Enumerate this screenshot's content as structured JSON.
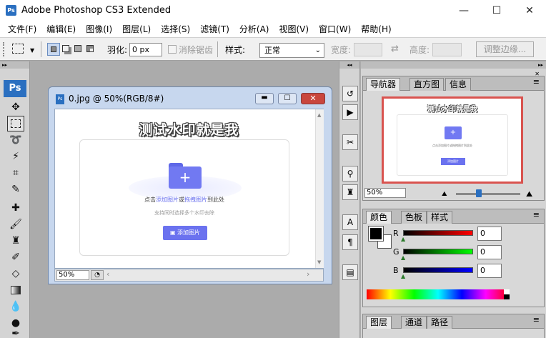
{
  "app": {
    "icon_text": "Ps",
    "title": "Adobe Photoshop CS3 Extended"
  },
  "window_controls": {
    "minimize": "—",
    "maximize": "☐",
    "close": "✕"
  },
  "menu": [
    "文件(F)",
    "编辑(E)",
    "图像(I)",
    "图层(L)",
    "选择(S)",
    "滤镜(T)",
    "分析(A)",
    "视图(V)",
    "窗口(W)",
    "帮助(H)"
  ],
  "options": {
    "feather_label": "羽化:",
    "feather_value": "0 px",
    "antialias_label": "消除锯齿",
    "style_label": "样式:",
    "style_value": "正常",
    "width_label": "宽度:",
    "height_label": "高度:",
    "refine_button": "调整边缘..."
  },
  "toolbox": {
    "logo": "Ps",
    "tools": [
      "move-tool",
      "marquee-tool",
      "lasso-tool",
      "magic-wand-tool",
      "crop-tool",
      "slice-tool",
      "healing-brush-tool",
      "brush-tool",
      "clone-stamp-tool",
      "history-brush-tool",
      "eraser-tool",
      "gradient-tool",
      "blur-tool",
      "dodge-tool",
      "pen-tool"
    ]
  },
  "document": {
    "title": "0.jpg @ 50%(RGB/8#)",
    "watermark": "测试水印就是我",
    "upload_line_prefix": "点击",
    "upload_link_add": "添加图片",
    "upload_line_or": "或",
    "upload_link_drag": "拖拽图片",
    "upload_line_suffix": "到此处",
    "upload_hint": "支持同时选择多个水印去除",
    "add_button": "添加图片",
    "zoom": "50%"
  },
  "navigator_panel": {
    "tabs": [
      "导航器",
      "直方图",
      "信息"
    ],
    "zoom": "50%",
    "thumb_watermark": "测试水印就是我",
    "thumb_upload": "点击添加图片或拖拽图片到此处",
    "thumb_button": "添加图片"
  },
  "color_panel": {
    "tabs": [
      "颜色",
      "色板",
      "样式"
    ],
    "channels": [
      {
        "label": "R",
        "value": "0"
      },
      {
        "label": "G",
        "value": "0"
      },
      {
        "label": "B",
        "value": "0"
      }
    ]
  },
  "layers_panel": {
    "tabs": [
      "图层",
      "通道",
      "路径"
    ]
  },
  "colors": {
    "accent": "#6b72ef",
    "selection": "#d9534f",
    "ps_blue": "#2a6fc0"
  }
}
